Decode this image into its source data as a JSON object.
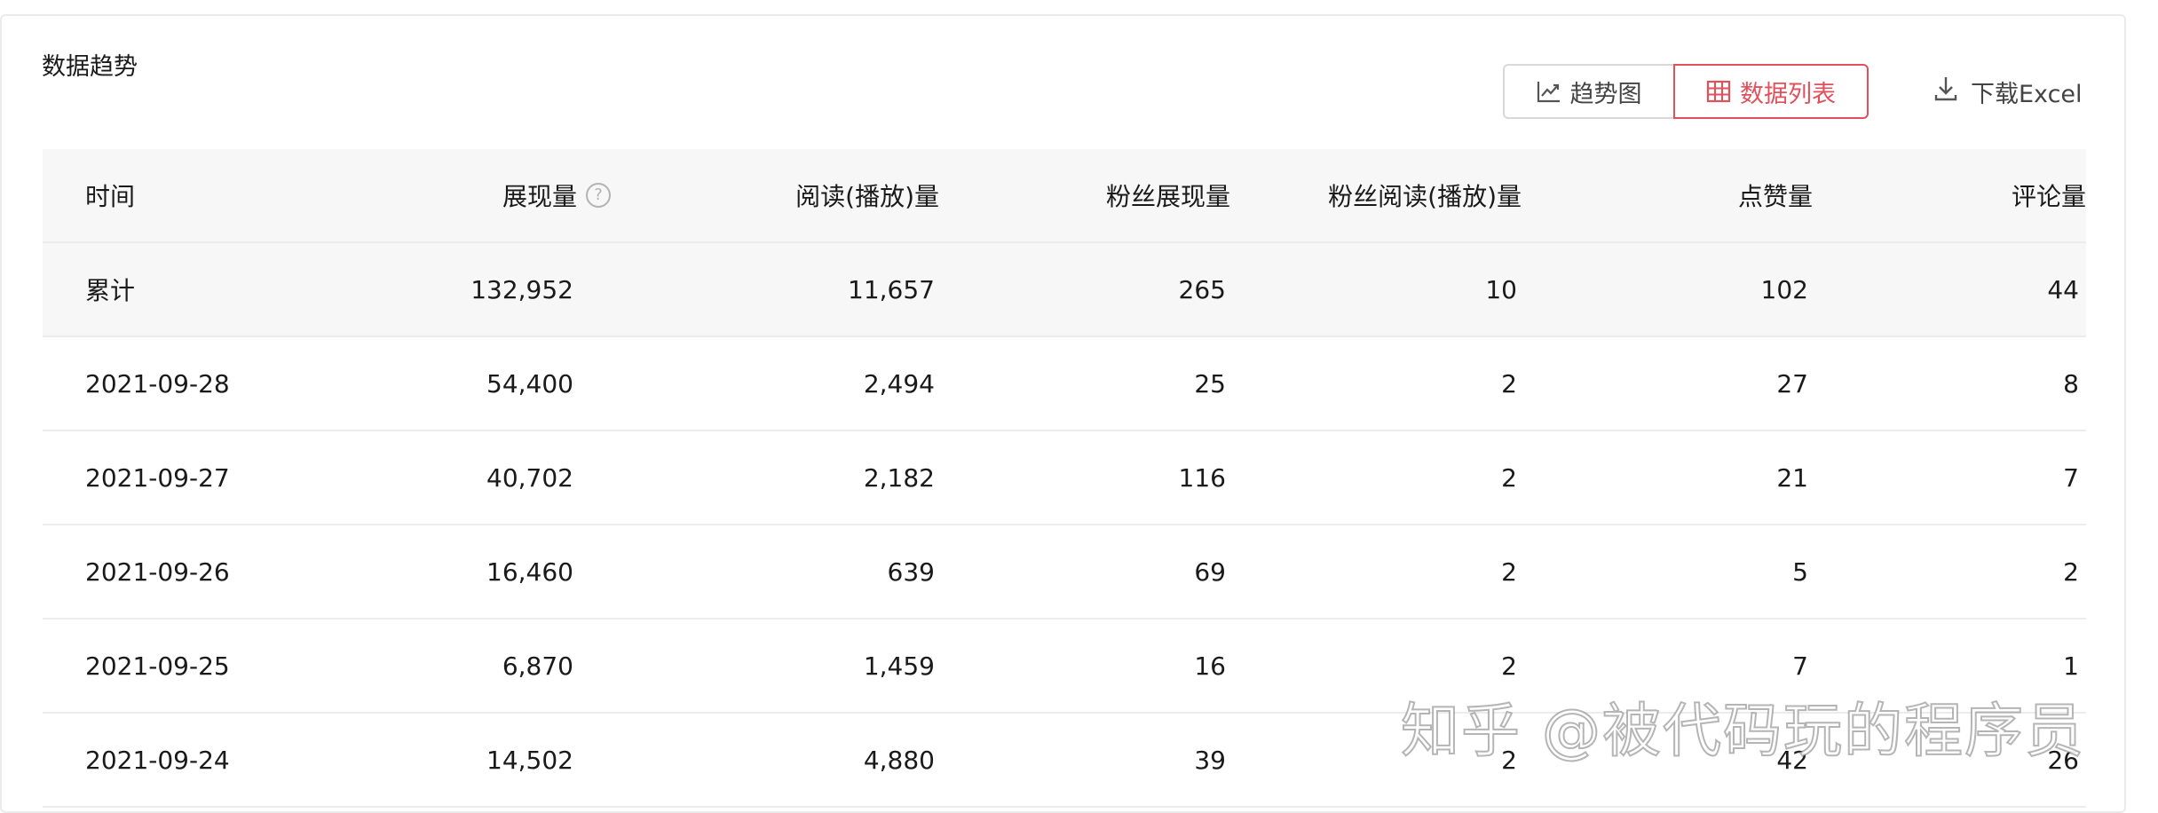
{
  "section": {
    "title": "数据趋势"
  },
  "view_toggle": {
    "trend_label": "趋势图",
    "list_label": "数据列表",
    "active": "数据列表",
    "active_color": "#e0515c"
  },
  "download": {
    "label": "下载Excel"
  },
  "table": {
    "headers": [
      "时间",
      "展现量",
      "阅读(播放)量",
      "粉丝展现量",
      "粉丝阅读(播放)量",
      "点赞量",
      "评论量"
    ],
    "rows": [
      [
        "累计",
        "132,952",
        "11,657",
        "265",
        "10",
        "102",
        "44"
      ],
      [
        "2021-09-28",
        "54,400",
        "2,494",
        "25",
        "2",
        "27",
        "8"
      ],
      [
        "2021-09-27",
        "40,702",
        "2,182",
        "116",
        "2",
        "21",
        "7"
      ],
      [
        "2021-09-26",
        "16,460",
        "639",
        "69",
        "2",
        "5",
        "2"
      ],
      [
        "2021-09-25",
        "6,870",
        "1,459",
        "16",
        "2",
        "7",
        "1"
      ],
      [
        "2021-09-24",
        "14,502",
        "4,880",
        "39",
        "2",
        "42",
        "26"
      ]
    ]
  },
  "watermark": "知乎 @被代码玩的程序员"
}
